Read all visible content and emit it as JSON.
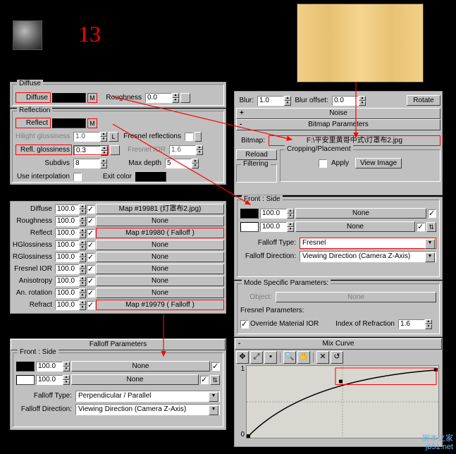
{
  "number_label": "13",
  "diffuse": {
    "title": "Diffuse",
    "diffuse_lbl": "Diffuse",
    "rough_lbl": "Roughness",
    "rough_val": "0.0",
    "m": "M"
  },
  "reflection": {
    "title": "Reflection",
    "reflect_lbl": "Reflect",
    "m": "M",
    "hilight_lbl": "Hilight glossiness",
    "hilight_val": "1.0",
    "l": "L",
    "fresnel_lbl": "Fresnel reflections",
    "reflg_lbl": "Refl. glossiness",
    "reflg_val": "0.3",
    "fresnelior_lbl": "Fresnel IOR",
    "fresnelior_val": "1.6",
    "subdivs_lbl": "Subdivs",
    "subdivs_val": "8",
    "maxdepth_lbl": "Max depth",
    "maxdepth_val": "5",
    "useinterp_lbl": "Use interpolation",
    "exitcolor_lbl": "Exit color"
  },
  "maps": {
    "rows": [
      {
        "name": "Diffuse",
        "val": "100.0",
        "map": "Map #19981 (灯罩布2.jpg)"
      },
      {
        "name": "Roughness",
        "val": "100.0",
        "map": "None"
      },
      {
        "name": "Reflect",
        "val": "100.0",
        "map": "Map #19980  ( Falloff )"
      },
      {
        "name": "HGlossiness",
        "val": "100.0",
        "map": "None"
      },
      {
        "name": "RGlossiness",
        "val": "100.0",
        "map": "None"
      },
      {
        "name": "Fresnel IOR",
        "val": "100.0",
        "map": "None"
      },
      {
        "name": "Anisotropy",
        "val": "100.0",
        "map": "None"
      },
      {
        "name": "An. rotation",
        "val": "100.0",
        "map": "None"
      },
      {
        "name": "Refract",
        "val": "100.0",
        "map": "Map #19979  ( Falloff )"
      }
    ]
  },
  "falloff1": {
    "title": "Falloff Parameters",
    "front_side": "Front : Side",
    "v1": "100.0",
    "map1": "None",
    "v2": "100.0",
    "map2": "None",
    "type_lbl": "Falloff Type:",
    "type_val": "Perpendicular / Parallel",
    "dir_lbl": "Falloff Direction:",
    "dir_val": "Viewing Direction (Camera Z-Axis)"
  },
  "bitmap": {
    "blur_lbl": "Blur:",
    "blur_val": "1.0",
    "bluroff_lbl": "Blur offset:",
    "bluroff_val": "0.0",
    "rotate": "Rotate",
    "noise": "Noise",
    "bp": "Bitmap Parameters",
    "bitmap_lbl": "Bitmap:",
    "bitmap_val": "F:\\平安里黄哥中式\\灯罩布2.jpg",
    "reload": "Reload",
    "crop_title": "Cropping/Placement",
    "apply": "Apply",
    "view": "View Image",
    "filtering": "Filtering"
  },
  "falloff2": {
    "front_side": "Front : Side",
    "v1": "100.0",
    "map1": "None",
    "v2": "100.0",
    "map2": "None",
    "type_lbl": "Falloff Type:",
    "type_val": "Fresnel",
    "dir_lbl": "Falloff Direction:",
    "dir_val": "Viewing Direction (Camera Z-Axis)"
  },
  "mode": {
    "title": "Mode Specific Parameters:",
    "obj_lbl": "Object:",
    "obj_val": "None",
    "fp": "Fresnel Parameters:",
    "override": "Override Material IOR",
    "ior_lbl": "Index of Refraction",
    "ior_val": "1.6"
  },
  "mix": {
    "title": "Mix Curve",
    "y1": "1",
    "y0": "0"
  },
  "watermark": "脚本之家\njb51.net"
}
